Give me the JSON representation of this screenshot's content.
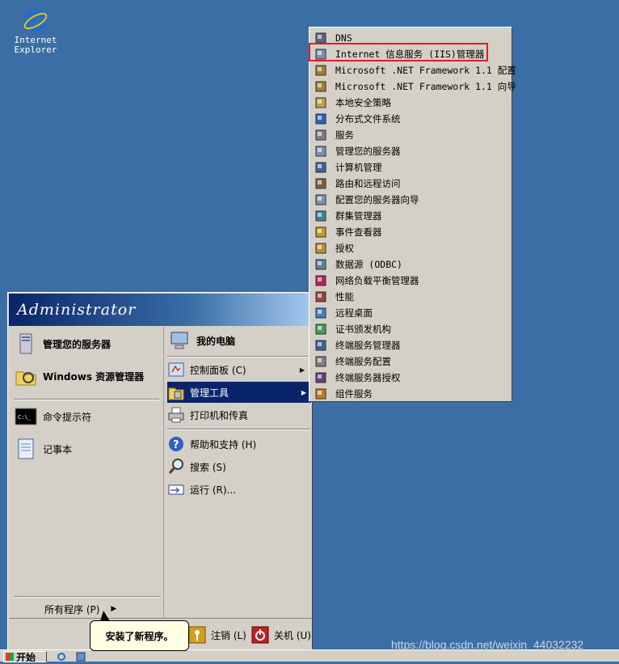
{
  "desktop": {
    "ie_label": "Internet\nExplorer"
  },
  "start_menu": {
    "user": "Administrator",
    "left_items": [
      {
        "label": "管理您的服务器",
        "icon": "server-manage-icon"
      },
      {
        "label": "Windows 资源管理器",
        "icon": "explorer-icon"
      },
      {
        "label": "命令提示符",
        "icon": "cmd-icon"
      },
      {
        "label": "记事本",
        "icon": "notepad-icon"
      }
    ],
    "all_programs": "所有程序 (P)",
    "right_items": [
      {
        "label": "我的电脑",
        "icon": "my-computer-icon"
      },
      {
        "label": "控制面板 (C)",
        "icon": "control-panel-icon"
      },
      {
        "label": "管理工具",
        "icon": "admin-tools-icon"
      },
      {
        "label": "打印机和传真",
        "icon": "printer-icon"
      },
      {
        "label": "帮助和支持 (H)",
        "icon": "help-icon"
      },
      {
        "label": "搜索 (S)",
        "icon": "search-icon"
      },
      {
        "label": "运行 (R)...",
        "icon": "run-icon"
      }
    ],
    "logoff": "注销 (L)",
    "shutdown": "关机 (U)"
  },
  "submenu": {
    "items": [
      "DNS",
      "Internet 信息服务 (IIS)管理器",
      "Microsoft .NET Framework 1.1 配置",
      "Microsoft .NET Framework 1.1 向导",
      "本地安全策略",
      "分布式文件系统",
      "服务",
      "管理您的服务器",
      "计算机管理",
      "路由和远程访问",
      "配置您的服务器向导",
      "群集管理器",
      "事件查看器",
      "授权",
      "数据源 (ODBC)",
      "网络负载平衡管理器",
      "性能",
      "远程桌面",
      "证书颁发机构",
      "终端服务管理器",
      "终端服务配置",
      "终端服务器授权",
      "组件服务"
    ]
  },
  "tooltip": "安装了新程序。",
  "taskbar": {
    "start": "开始"
  },
  "watermark": "https://blog.csdn.net/weixin_44032232",
  "colors": {
    "desktop": "#3a6ea5",
    "menu_bg": "#d4d0c8",
    "selection": "#0a246a",
    "highlight_box": "#e02020"
  }
}
